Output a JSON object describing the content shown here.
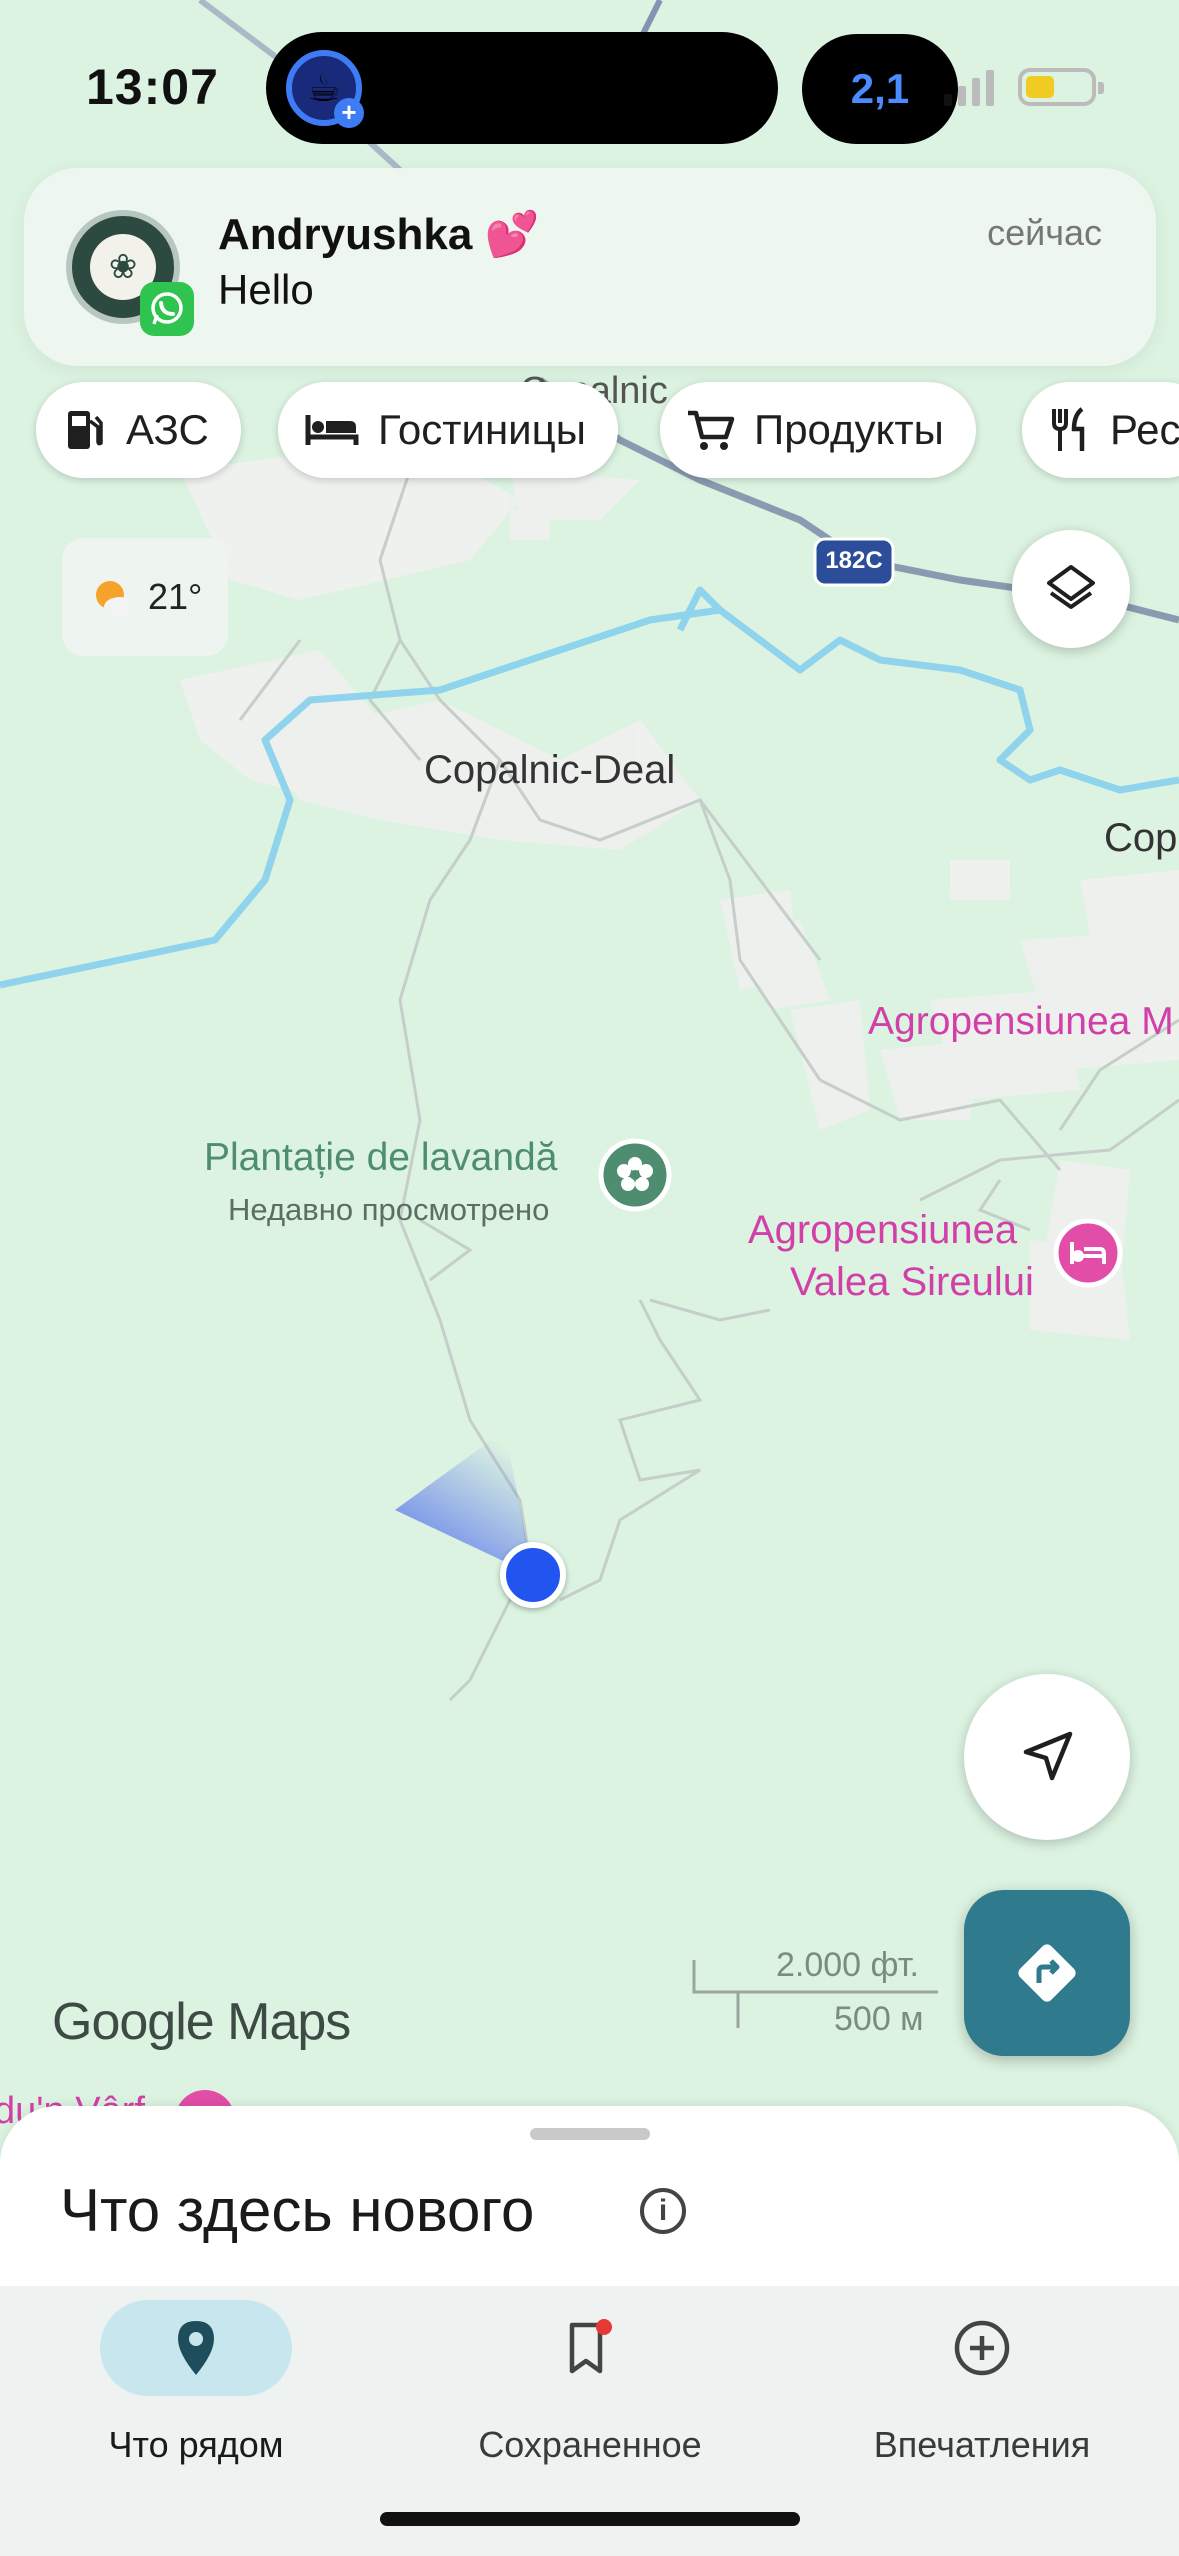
{
  "status_bar": {
    "time": "13:07",
    "live_activity": "2,1",
    "coffee_icon": "coffee-cup-icon"
  },
  "notification": {
    "title": "Andryushka 💕",
    "message": "Hello",
    "time": "сейчас",
    "app": "WhatsApp"
  },
  "chips": [
    {
      "label": "АЗС",
      "icon": "gas-station-icon"
    },
    {
      "label": "Гостиницы",
      "icon": "hotel-bed-icon"
    },
    {
      "label": "Продукты",
      "icon": "shopping-cart-icon"
    },
    {
      "label": "Рес",
      "icon": "restaurant-icon"
    }
  ],
  "weather": {
    "temperature": "21°",
    "icon": "partly-cloudy-icon"
  },
  "map": {
    "road_shield": "182C",
    "places": {
      "copalnic_top": "Copalnic",
      "copalnic_deal": "Copalnic-Deal",
      "cop_right": "Cop",
      "agro_m": "Agropensiunea M",
      "lavanda": "Plantație de lavandă",
      "lavanda_sub": "Недавно просмотрено",
      "agro_valea_1": "Agropensiunea",
      "agro_valea_2": "Valea Sireului",
      "bottom_left": "du'n Vârf"
    },
    "scale_feet": "2.000 фт.",
    "scale_meters": "500 м",
    "brand": "Google Maps"
  },
  "sheet": {
    "title": "Что здесь нового"
  },
  "bottom_nav": [
    {
      "label": "Что рядом",
      "icon": "location-pin-icon",
      "active": true
    },
    {
      "label": "Сохраненное",
      "icon": "bookmark-icon",
      "badge": true
    },
    {
      "label": "Впечатления",
      "icon": "add-circle-icon"
    }
  ],
  "colors": {
    "map_bg": "#dcf3e1",
    "accent_teal": "#2f7a8c",
    "place_pink": "#d33fa8",
    "place_green": "#4e8d70",
    "location_blue": "#2255f0"
  }
}
